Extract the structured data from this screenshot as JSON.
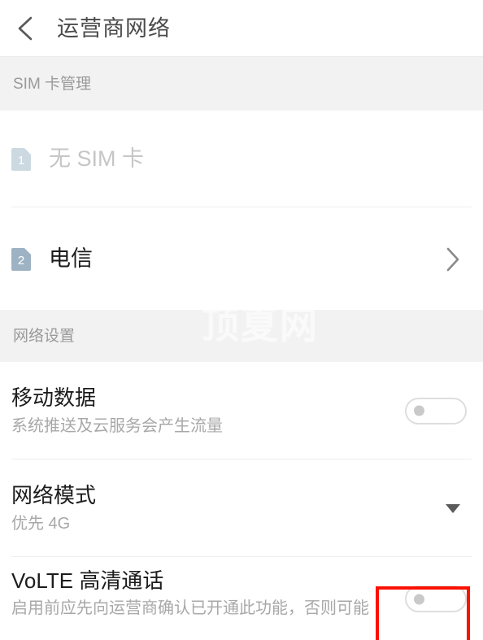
{
  "header": {
    "back_icon": "chevron-left-icon",
    "title": "运营商网络"
  },
  "watermark": {
    "text": "顶夏网"
  },
  "sections": {
    "sim": {
      "label": "SIM 卡管理",
      "rows": [
        {
          "badge": "1",
          "badge_icon": "sim-card-icon",
          "title": "无 SIM 卡",
          "state": "disabled",
          "accessory": "none"
        },
        {
          "badge": "2",
          "badge_icon": "sim-card-icon",
          "title": "电信",
          "state": "enabled",
          "accessory": "chevron-right-icon"
        }
      ]
    },
    "network": {
      "label": "网络设置",
      "rows": [
        {
          "title": "移动数据",
          "subtitle": "系统推送及云服务会产生流量",
          "control": "toggle",
          "toggle_state": "off"
        },
        {
          "title": "网络模式",
          "subtitle": "优先 4G",
          "control": "dropdown",
          "dropdown_icon": "caret-down-icon"
        },
        {
          "title": "VoLTE 高清通话",
          "subtitle": "启用前应先向运营商确认已开通此功能，否则可能",
          "control": "toggle",
          "toggle_state": "off",
          "highlighted": true
        }
      ]
    }
  },
  "annotation": {
    "shape": "rectangle",
    "color": "#fb1104",
    "target": "volte-toggle"
  },
  "colors": {
    "background": "#ffffff",
    "section_band": "#f2f2f2",
    "title_text": "#1c1c1c",
    "secondary_text": "#a8a8a8",
    "disabled_text": "#c6c6c6",
    "sim1_badge": "#cdd9e1",
    "sim2_badge": "#9db3c4",
    "divider": "#eeeeee",
    "annotation": "#fb1104"
  }
}
